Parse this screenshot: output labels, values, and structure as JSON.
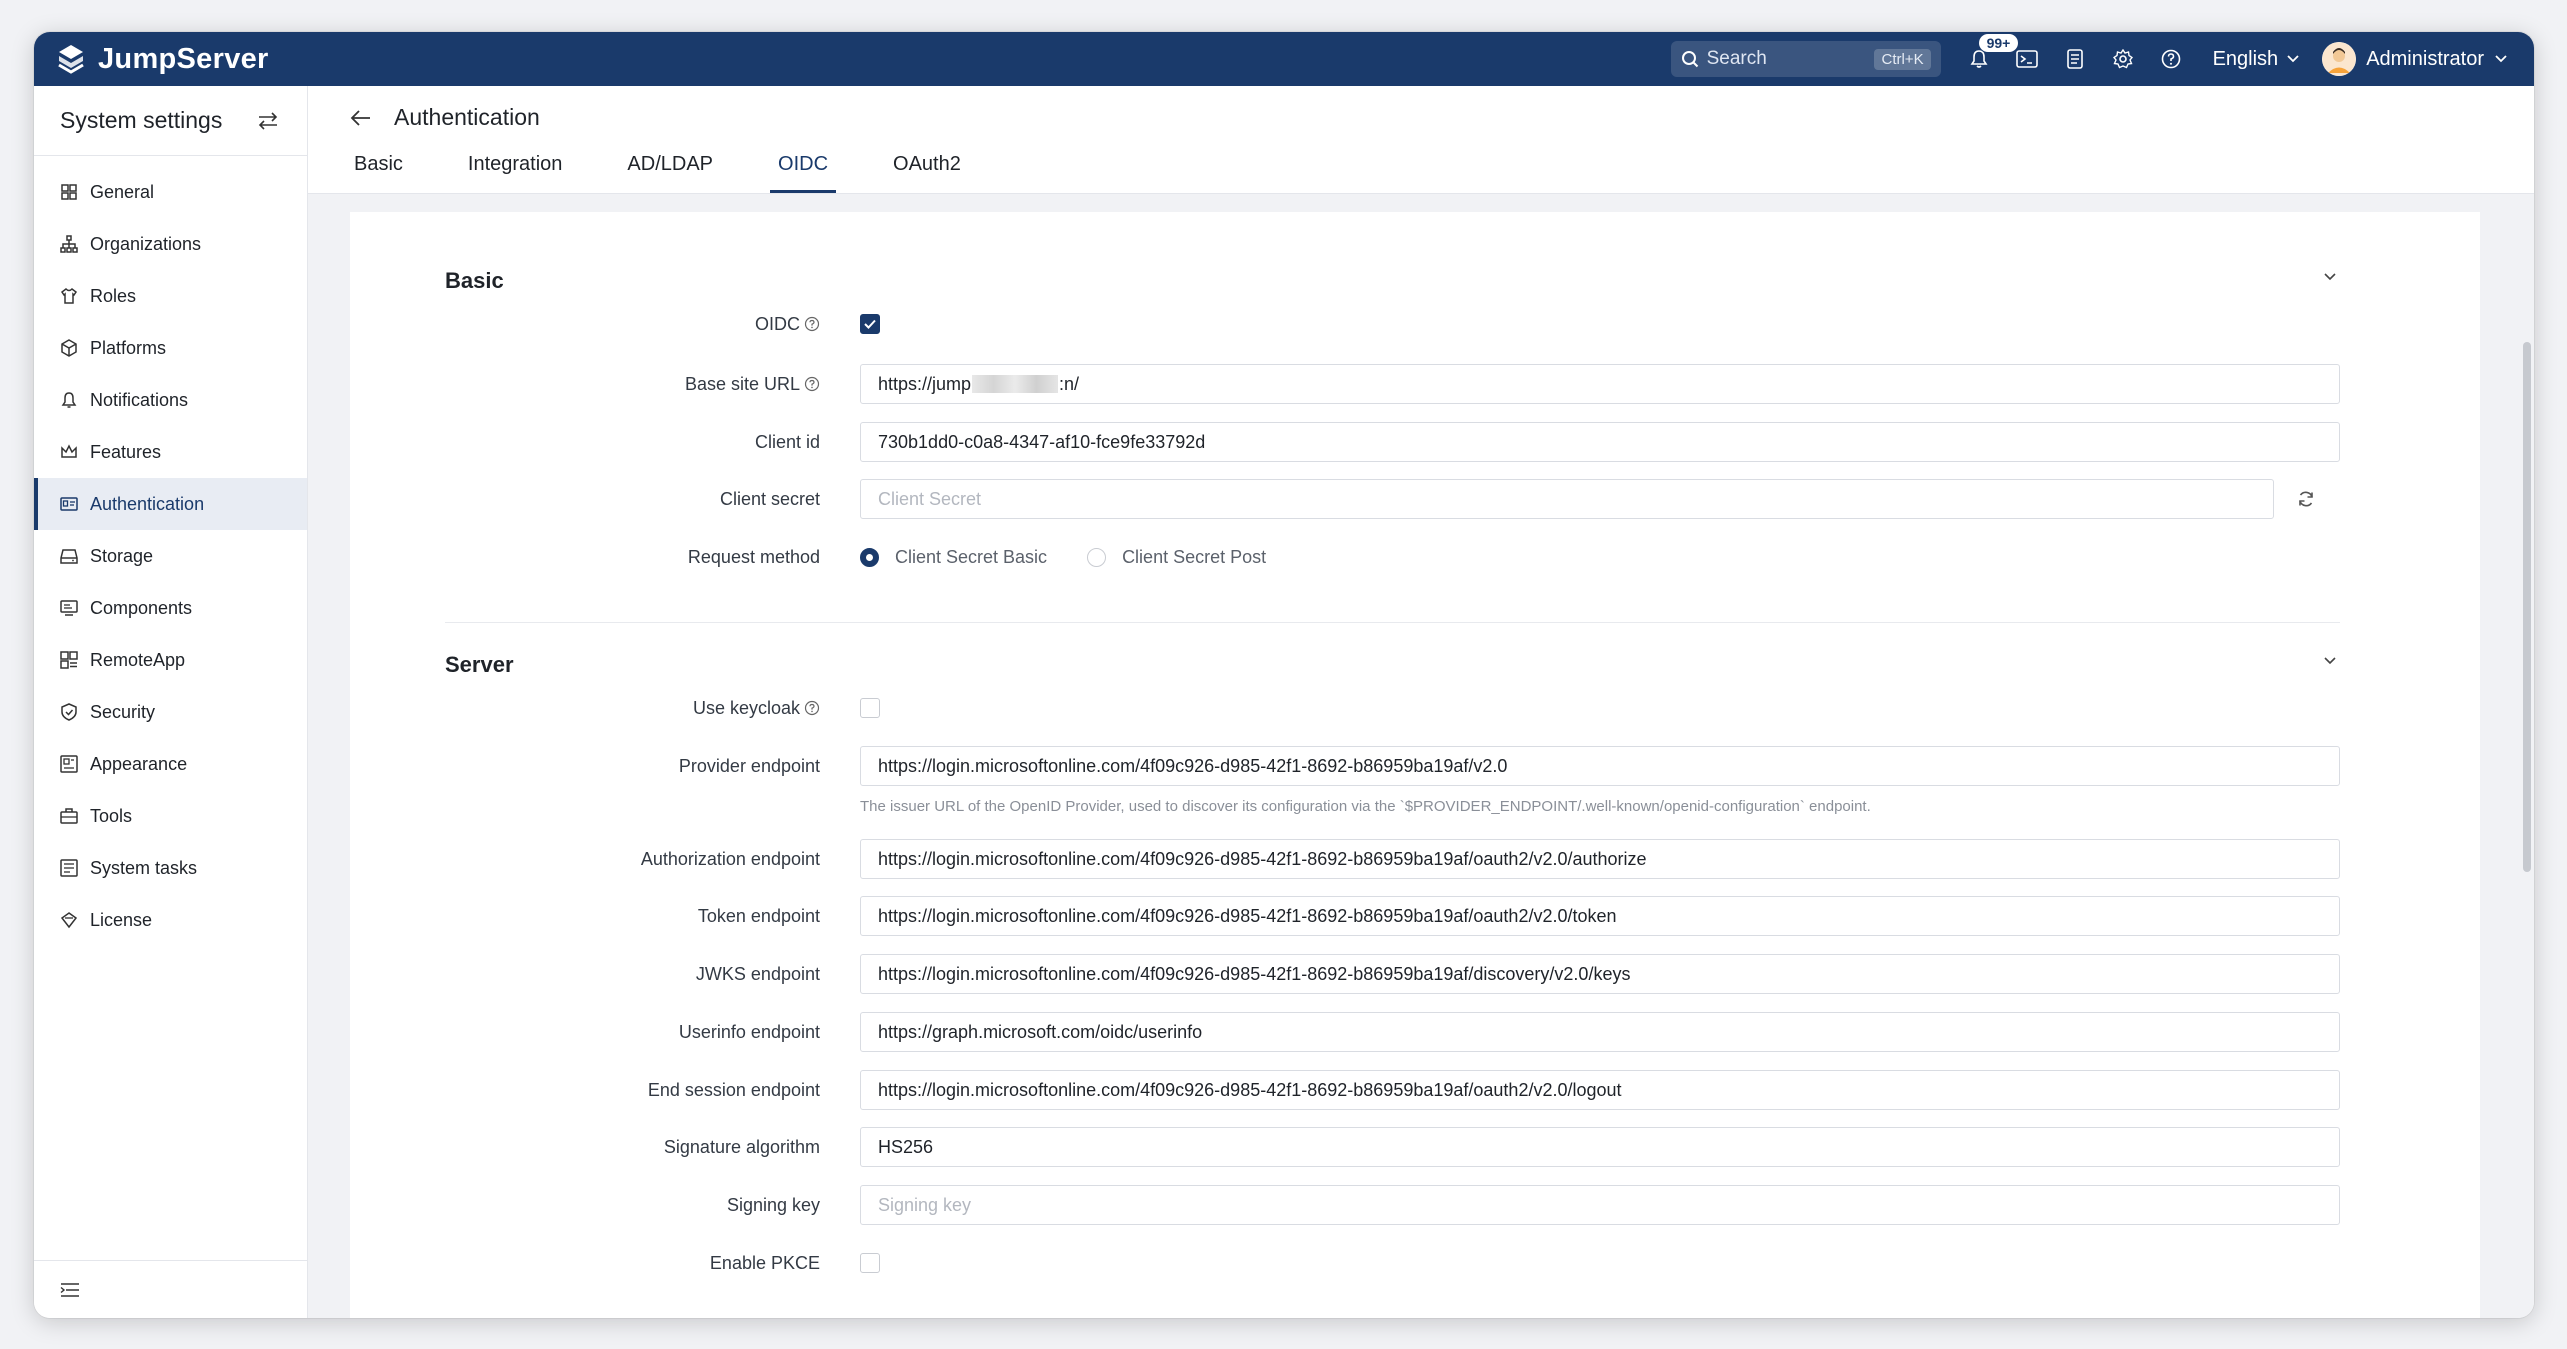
{
  "app": {
    "name": "JumpServer",
    "search_placeholder": "Search",
    "search_shortcut": "Ctrl+K",
    "notification_count": "99+",
    "language": "English",
    "user": "Administrator"
  },
  "sidebar": {
    "title": "System settings",
    "items": [
      {
        "label": "General",
        "icon": "grid-icon"
      },
      {
        "label": "Organizations",
        "icon": "org-icon"
      },
      {
        "label": "Roles",
        "icon": "shirt-icon"
      },
      {
        "label": "Platforms",
        "icon": "cube-icon"
      },
      {
        "label": "Notifications",
        "icon": "bell-icon"
      },
      {
        "label": "Features",
        "icon": "crown-icon"
      },
      {
        "label": "Authentication",
        "icon": "id-card-icon",
        "active": true
      },
      {
        "label": "Storage",
        "icon": "drive-icon"
      },
      {
        "label": "Components",
        "icon": "monitor-icon"
      },
      {
        "label": "RemoteApp",
        "icon": "apps-icon"
      },
      {
        "label": "Security",
        "icon": "shield-icon"
      },
      {
        "label": "Appearance",
        "icon": "palette-icon"
      },
      {
        "label": "Tools",
        "icon": "toolbox-icon"
      },
      {
        "label": "System tasks",
        "icon": "tasks-icon"
      },
      {
        "label": "License",
        "icon": "license-icon"
      }
    ]
  },
  "page": {
    "title": "Authentication",
    "tabs": [
      "Basic",
      "Integration",
      "AD/LDAP",
      "OIDC",
      "OAuth2"
    ],
    "active_tab": "OIDC"
  },
  "form": {
    "basic": {
      "title": "Basic",
      "oidc_label": "OIDC",
      "oidc_checked": true,
      "base_site_url_label": "Base site URL",
      "base_site_url_prefix": "https://jump",
      "base_site_url_suffix": ":n/",
      "client_id_label": "Client id",
      "client_id_value": "730b1dd0-c0a8-4347-af10-fce9fe33792d",
      "client_secret_label": "Client secret",
      "client_secret_placeholder": "Client Secret",
      "request_method_label": "Request method",
      "request_method_options": [
        "Client Secret Basic",
        "Client Secret Post"
      ],
      "request_method_selected": "Client Secret Basic"
    },
    "server": {
      "title": "Server",
      "use_keycloak_label": "Use keycloak",
      "use_keycloak_checked": false,
      "provider_endpoint_label": "Provider endpoint",
      "provider_endpoint_value": "https://login.microsoftonline.com/4f09c926-d985-42f1-8692-b86959ba19af/v2.0",
      "provider_endpoint_hint": "The issuer URL of the OpenID Provider, used to discover its configuration via the `$PROVIDER_ENDPOINT/.well-known/openid-configuration` endpoint.",
      "authorization_endpoint_label": "Authorization endpoint",
      "authorization_endpoint_value": "https://login.microsoftonline.com/4f09c926-d985-42f1-8692-b86959ba19af/oauth2/v2.0/authorize",
      "token_endpoint_label": "Token endpoint",
      "token_endpoint_value": "https://login.microsoftonline.com/4f09c926-d985-42f1-8692-b86959ba19af/oauth2/v2.0/token",
      "jwks_endpoint_label": "JWKS endpoint",
      "jwks_endpoint_value": "https://login.microsoftonline.com/4f09c926-d985-42f1-8692-b86959ba19af/discovery/v2.0/keys",
      "userinfo_endpoint_label": "Userinfo endpoint",
      "userinfo_endpoint_value": "https://graph.microsoft.com/oidc/userinfo",
      "end_session_endpoint_label": "End session endpoint",
      "end_session_endpoint_value": "https://login.microsoftonline.com/4f09c926-d985-42f1-8692-b86959ba19af/oauth2/v2.0/logout",
      "signature_algorithm_label": "Signature algorithm",
      "signature_algorithm_value": "HS256",
      "signing_key_label": "Signing key",
      "signing_key_placeholder": "Signing key",
      "enable_pkce_label": "Enable PKCE",
      "enable_pkce_checked": false
    }
  },
  "colors": {
    "brand": "#1a3a6b",
    "active_bg": "#e8ecf3"
  }
}
